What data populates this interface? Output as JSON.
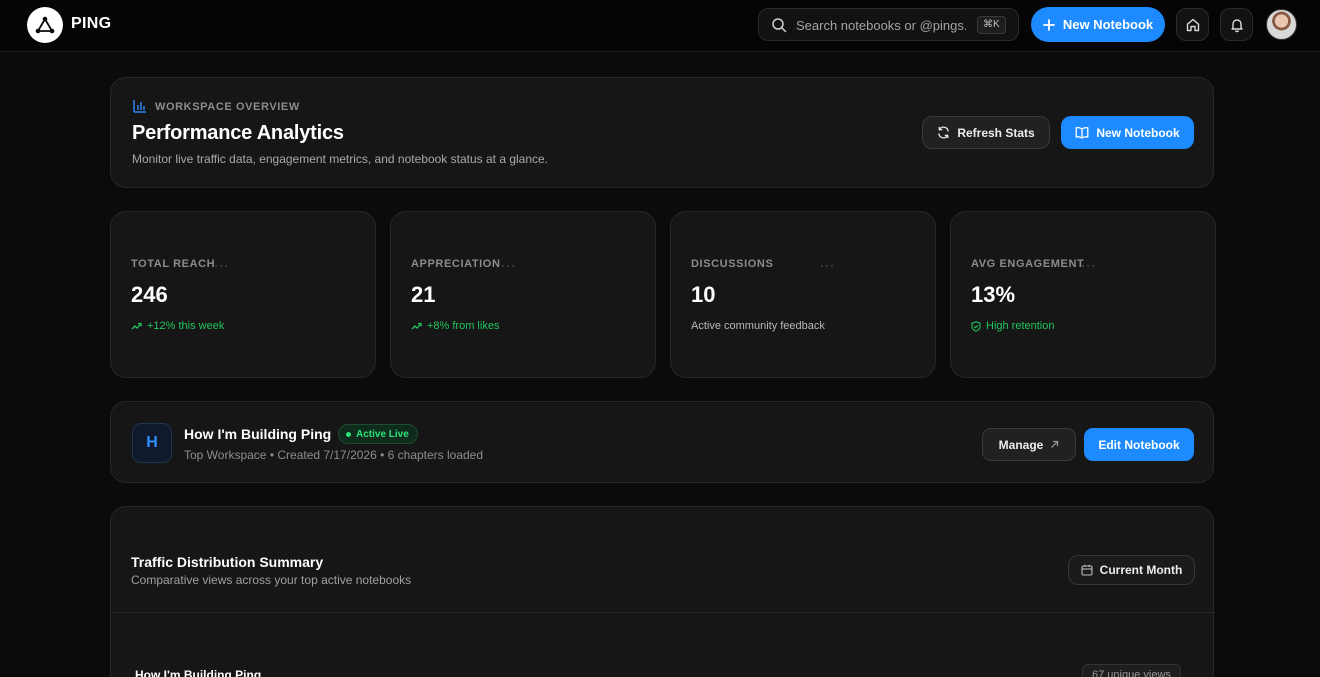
{
  "header": {
    "brand": "PING",
    "search_placeholder": "Search notebooks or @pings...",
    "search_shortcut": "⌘K",
    "new_notebook_label": "New Notebook"
  },
  "overview": {
    "eyebrow": "WORKSPACE OVERVIEW",
    "title": "Performance Analytics",
    "subtitle": "Monitor live traffic data, engagement metrics, and notebook status at a glance.",
    "refresh_label": "Refresh Stats",
    "new_notebook_label": "New Notebook"
  },
  "stats": [
    {
      "label": "TOTAL REACH",
      "value": "246",
      "note": "+12% this week",
      "note_style": "trend-up",
      "more": "···"
    },
    {
      "label": "APPRECIATION",
      "value": "21",
      "note": "+8% from likes",
      "note_style": "trend-up",
      "more": "···"
    },
    {
      "label": "DISCUSSIONS",
      "value": "10",
      "note": "Active community feedback",
      "note_style": "plain",
      "more": "···"
    },
    {
      "label": "AVG ENGAGEMENT",
      "value": "13%",
      "note": "High retention",
      "note_style": "shield",
      "more": "···"
    }
  ],
  "notebook": {
    "initial": "H",
    "title": "How I'm Building Ping",
    "status": "Active Live",
    "meta": "Top Workspace • Created 7/17/2026 • 6 chapters loaded",
    "manage_label": "Manage",
    "edit_label": "Edit Notebook"
  },
  "traffic": {
    "title": "Traffic Distribution Summary",
    "subtitle": "Comparative views across your top active notebooks",
    "period_label": "Current Month",
    "rows": [
      {
        "name": "How I'm Building Ping",
        "views": "67 unique views"
      }
    ]
  },
  "colors": {
    "accent": "#1d8bff",
    "success": "#22c55e",
    "background": "#0b0b0b",
    "card": "#161616"
  }
}
